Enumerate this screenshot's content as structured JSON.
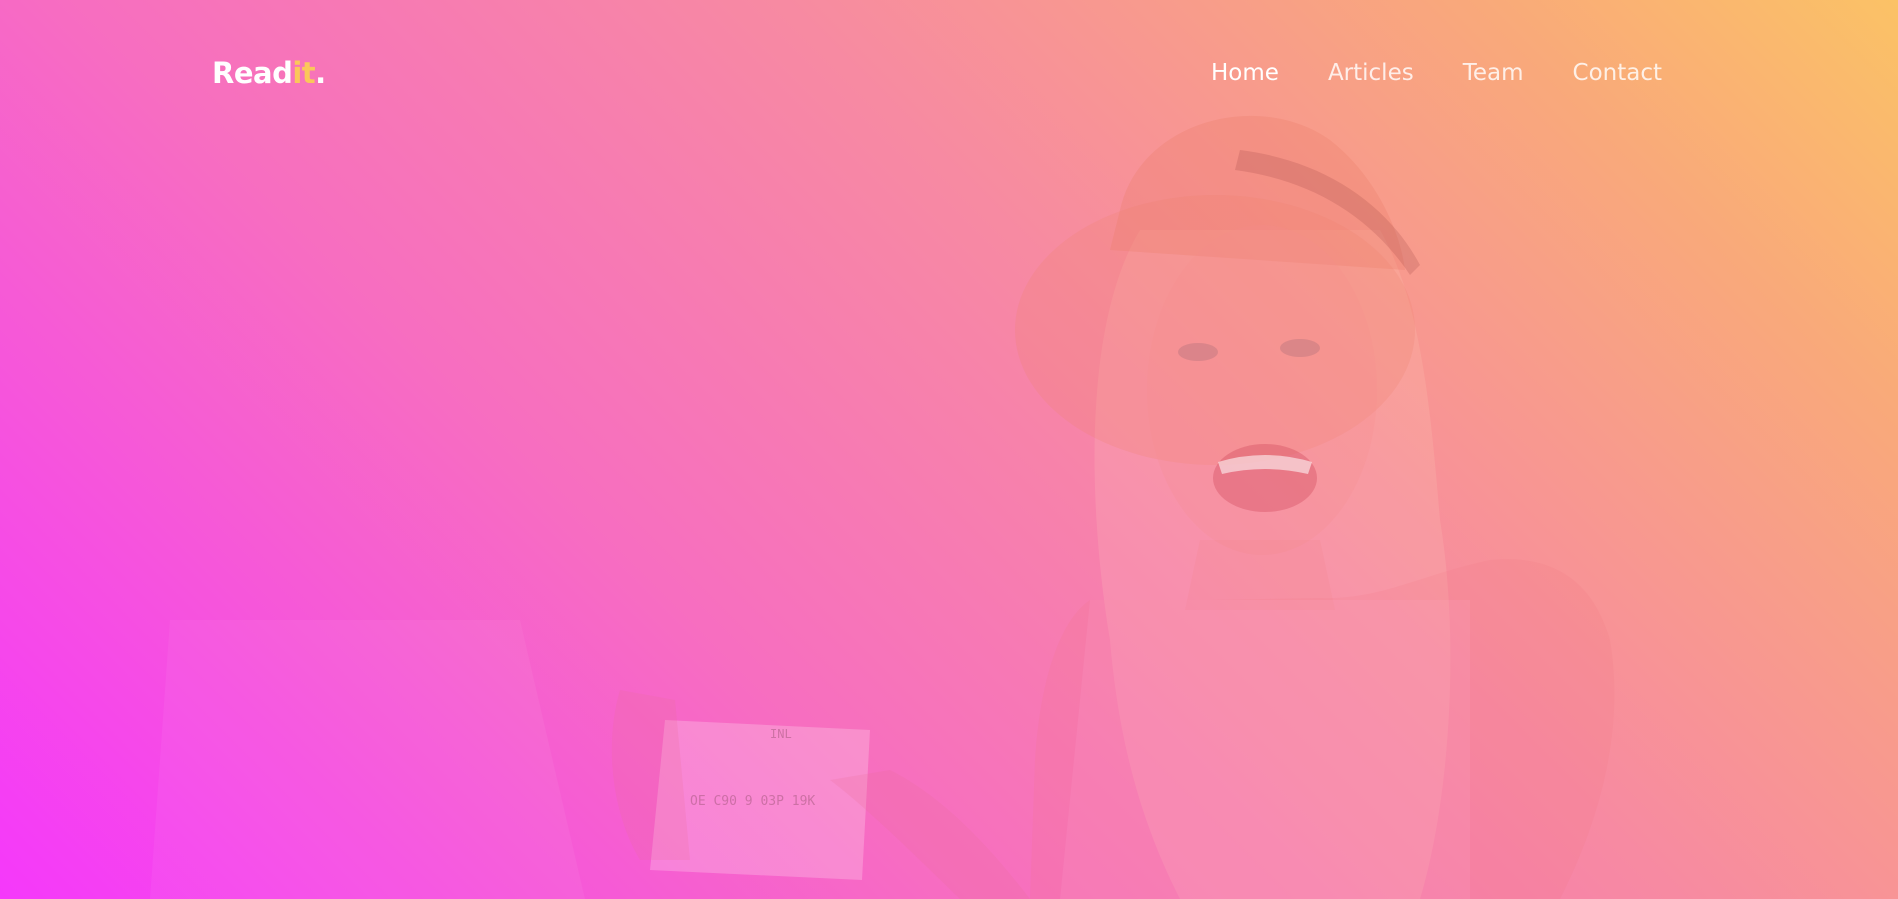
{
  "brand": {
    "logo_main": "Read",
    "logo_accent": "it",
    "logo_dot": "."
  },
  "nav": {
    "items": [
      {
        "label": "Home"
      },
      {
        "label": "Articles"
      },
      {
        "label": "Team"
      },
      {
        "label": "Contact"
      }
    ]
  },
  "colors": {
    "gradient_start": "#f538fb",
    "gradient_end": "#fbc266",
    "logo_accent": "#fbc75a",
    "text": "#ffffff"
  }
}
